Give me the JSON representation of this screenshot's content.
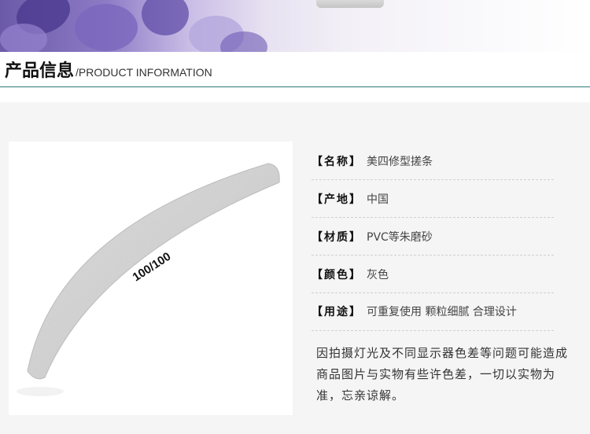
{
  "header": {
    "title_cn": "产品信息",
    "title_en": "/PRODUCT INFORMATION"
  },
  "product": {
    "image_label": "100/100",
    "color": "#d2d2d2"
  },
  "specs": [
    {
      "label": "【名称】",
      "value": "美四修型搓条"
    },
    {
      "label": "【产地】",
      "value": "中国"
    },
    {
      "label": "【材质】",
      "value": "PVC等朱磨砂"
    },
    {
      "label": "【颜色】",
      "value": "灰色"
    },
    {
      "label": "【用途】",
      "value": "可重复使用 颗粒细腻 合理设计"
    }
  ],
  "notice": "因拍摄灯光及不同显示器色差等问题可能造成商品图片与实物有些许色差，一切以实物为准，忘亲谅解。",
  "colors": {
    "divider": "#2f7a74",
    "banner_accent": "#6b5aa8"
  }
}
